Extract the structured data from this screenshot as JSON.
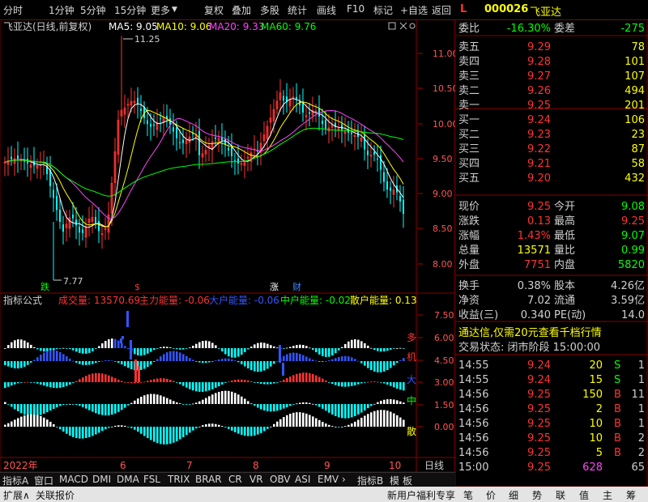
{
  "toolbar": {
    "left_items": [
      "分时",
      "1分钟",
      "5分钟",
      "15分钟",
      "更多"
    ],
    "right_items": [
      "复权",
      "叠加",
      "多股",
      "统计",
      "画线",
      "F10",
      "标记",
      "+自选",
      "返回"
    ],
    "more_arrow": "▼"
  },
  "chart_header": {
    "title": "飞亚达(日线,前复权)",
    "ma": [
      {
        "label": "MA5: 9.05",
        "color": "#ffffff"
      },
      {
        "label": "MA10: 9.06",
        "color": "#ffff00"
      },
      {
        "label": "MA20: 9.33",
        "color": "#ff44ff"
      },
      {
        "label": "MA60: 9.76",
        "color": "#00ff00"
      }
    ]
  },
  "price_axis": [
    "11.00",
    "10.50",
    "10.00",
    "9.50",
    "9.00",
    "8.50",
    "8.00"
  ],
  "annotations": {
    "high": "11.25",
    "low": "7.77"
  },
  "markers": [
    {
      "text": "跌",
      "color": "#00ff00"
    },
    {
      "text": "$",
      "color": "#ff3333"
    },
    {
      "text": "涨",
      "color": "#ffffff"
    },
    {
      "text": "财",
      "color": "#4488ff"
    }
  ],
  "indicator_header": {
    "name": "指标公式",
    "values": [
      {
        "label": "成交量: 13570.69",
        "color": "#ff3333"
      },
      {
        "label": "主力能量: -0.06",
        "color": "#ff3333"
      },
      {
        "label": "大户能量: -0.06",
        "color": "#3355ff"
      },
      {
        "label": "中户能量: -0.02",
        "color": "#00ff00"
      },
      {
        "label": "散户能量: 0.13",
        "color": "#ffff00"
      }
    ]
  },
  "indicator_axis": [
    "7.50",
    "6.00",
    "4.50",
    "3.00",
    "1.50",
    "0.00"
  ],
  "indicator_side_labels": [
    {
      "text": "多",
      "color": "#ff3333"
    },
    {
      "text": "机",
      "color": "#ff3333"
    },
    {
      "text": "大",
      "color": "#3355ff"
    },
    {
      "text": "中",
      "color": "#00ff00"
    },
    {
      "text": "散",
      "color": "#ffff00"
    }
  ],
  "date_axis": {
    "year": "2022年",
    "months": [
      "6",
      "7",
      "8",
      "9",
      "10"
    ],
    "period": "日线"
  },
  "tabs": [
    "指标A",
    "窗口",
    "MACD",
    "DMI",
    "DMA",
    "FSL",
    "TRIX",
    "BRAR",
    "CR",
    "VR",
    "OBV",
    "ASI",
    "EMV",
    "指标B",
    "模",
    "板"
  ],
  "bottom_bar": {
    "left": [
      "扩展∧",
      "关联报价"
    ],
    "promo": "新用户福利专享",
    "right_tabs": [
      "笔",
      "价",
      "细",
      "势",
      "联",
      "值",
      "主",
      "筹"
    ]
  },
  "stock": {
    "code": "000026",
    "name": "飞亚达",
    "flag": "L"
  },
  "commission": {
    "ratio_label": "委比",
    "ratio": "-16.30%",
    "diff_label": "委差",
    "diff": "-275"
  },
  "asks": [
    {
      "label": "卖五",
      "price": "9.29",
      "vol": "78"
    },
    {
      "label": "卖四",
      "price": "9.28",
      "vol": "101"
    },
    {
      "label": "卖三",
      "price": "9.27",
      "vol": "107"
    },
    {
      "label": "卖二",
      "price": "9.26",
      "vol": "494"
    },
    {
      "label": "卖一",
      "price": "9.25",
      "vol": "201"
    }
  ],
  "bids": [
    {
      "label": "买一",
      "price": "9.24",
      "vol": "106"
    },
    {
      "label": "买二",
      "price": "9.23",
      "vol": "23"
    },
    {
      "label": "买三",
      "price": "9.22",
      "vol": "87"
    },
    {
      "label": "买四",
      "price": "9.21",
      "vol": "58"
    },
    {
      "label": "买五",
      "price": "9.20",
      "vol": "432"
    }
  ],
  "quote": [
    {
      "l1": "现价",
      "v1": "9.25",
      "c1": "#ff3333",
      "l2": "今开",
      "v2": "9.08",
      "c2": "#00ff00"
    },
    {
      "l1": "涨跌",
      "v1": "0.13",
      "c1": "#ff3333",
      "l2": "最高",
      "v2": "9.25",
      "c2": "#ff3333"
    },
    {
      "l1": "涨幅",
      "v1": "1.43%",
      "c1": "#ff3333",
      "l2": "最低",
      "v2": "9.07",
      "c2": "#00ff00"
    },
    {
      "l1": "总量",
      "v1": "13571",
      "c1": "#ffff00",
      "l2": "量比",
      "v2": "0.99",
      "c2": "#00ff00"
    },
    {
      "l1": "外盘",
      "v1": "7751",
      "c1": "#ff3333",
      "l2": "内盘",
      "v2": "5820",
      "c2": "#00ff00"
    }
  ],
  "stats": [
    {
      "l1": "换手",
      "v1": "0.38%",
      "l2": "股本",
      "v2": "4.26亿"
    },
    {
      "l1": "净资",
      "v1": "7.02",
      "l2": "流通",
      "v2": "3.59亿"
    },
    {
      "l1": "收益(三)",
      "v1": "0.340",
      "l2": "PE(动)",
      "v2": "14.0"
    }
  ],
  "promo_line": "通达信,仅需20元查看千档行情",
  "trade_state": "交易状态: 闭市阶段 15:00:00",
  "ticks": [
    {
      "time": "14:55",
      "price": "9.24",
      "vol": "20",
      "side": "S",
      "count": "1"
    },
    {
      "time": "14:55",
      "price": "9.24",
      "vol": "15",
      "side": "S",
      "count": "1"
    },
    {
      "time": "14:56",
      "price": "9.25",
      "vol": "150",
      "side": "B",
      "count": "11"
    },
    {
      "time": "14:56",
      "price": "9.25",
      "vol": "2",
      "side": "B",
      "count": "1"
    },
    {
      "time": "14:56",
      "price": "9.25",
      "vol": "10",
      "side": "B",
      "count": "1"
    },
    {
      "time": "14:56",
      "price": "9.25",
      "vol": "10",
      "side": "B",
      "count": "2"
    },
    {
      "time": "14:56",
      "price": "9.25",
      "vol": "5",
      "side": "B",
      "count": "2"
    },
    {
      "time": "15:00",
      "price": "9.25",
      "vol": "628",
      "side": "",
      "count": "65"
    }
  ]
}
